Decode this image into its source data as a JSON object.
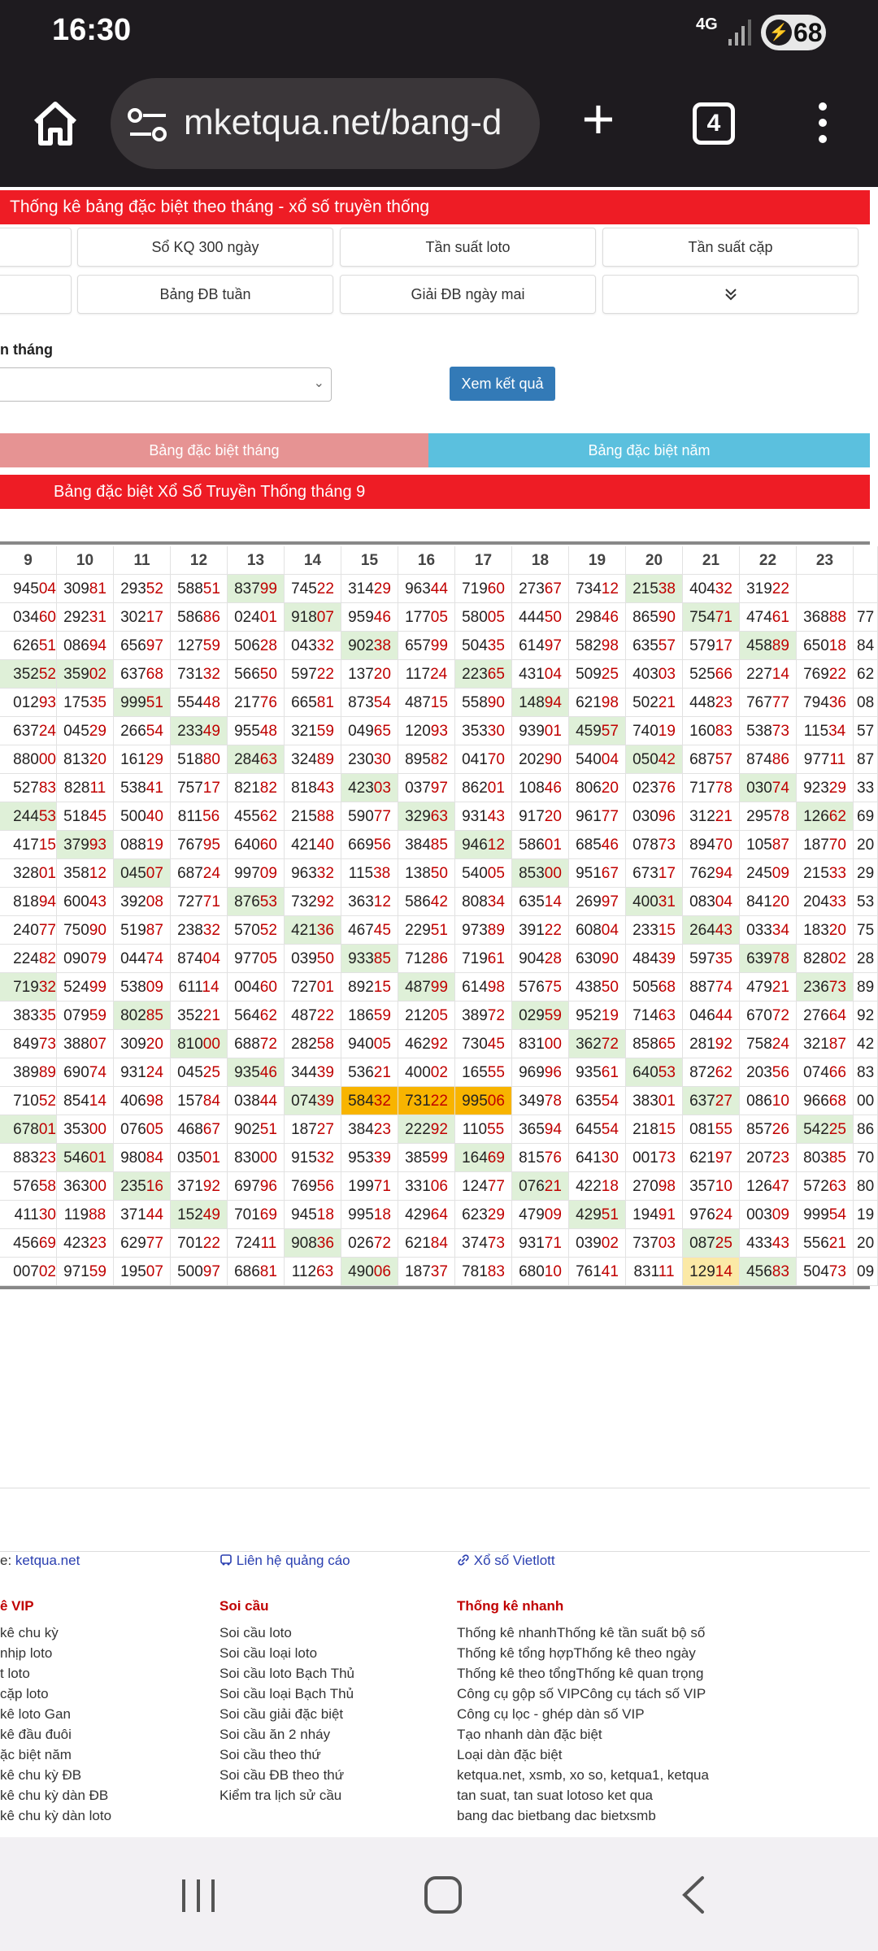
{
  "status": {
    "time": "16:30",
    "network": "4G",
    "battery": "68"
  },
  "browser": {
    "url": "mketqua.net/bang-d",
    "tab_count": "4"
  },
  "page": {
    "header": "Thống kê bảng đặc biệt theo tháng - xổ số truyền thống",
    "nav_row1": [
      "Sổ KQ 300 ngày",
      "Tần suất loto",
      "Tần suất cặp"
    ],
    "nav_row2": [
      "Bảng ĐB tuần",
      "Giải ĐB ngày mai"
    ],
    "month_label": "n tháng",
    "submit_label": "Xem kết quả",
    "tab_month": "Bảng đặc biệt tháng",
    "tab_year": "Bảng đặc biệt năm",
    "table_title": "Bảng đặc biệt Xổ Số Truyền Thống tháng 9"
  },
  "table": {
    "columns": [
      "9",
      "10",
      "11",
      "12",
      "13",
      "14",
      "15",
      "16",
      "17",
      "18",
      "19",
      "20",
      "21",
      "22",
      "23"
    ],
    "rows": [
      [
        "94504",
        "30981",
        "29352",
        "58851",
        "83799",
        "74522",
        "31429",
        "96344",
        "71960",
        "27367",
        "73412",
        "21538",
        "40432",
        "31922",
        "",
        ""
      ],
      [
        "03460",
        "29231",
        "30217",
        "58686",
        "02401",
        "91807",
        "95946",
        "17705",
        "58005",
        "44450",
        "29846",
        "86590",
        "75471",
        "47461",
        "36888",
        "77"
      ],
      [
        "62651",
        "08694",
        "65697",
        "12759",
        "50628",
        "04332",
        "90238",
        "65799",
        "50435",
        "61497",
        "58298",
        "63557",
        "57917",
        "45889",
        "65018",
        "84"
      ],
      [
        "35252",
        "35902",
        "63768",
        "73132",
        "56650",
        "59722",
        "13720",
        "11724",
        "22365",
        "43104",
        "50925",
        "40303",
        "52566",
        "22714",
        "76922",
        "62"
      ],
      [
        "01293",
        "17535",
        "99951",
        "55448",
        "21776",
        "66581",
        "87354",
        "48715",
        "55890",
        "14894",
        "62198",
        "50221",
        "44823",
        "76777",
        "79436",
        "08"
      ],
      [
        "63724",
        "04529",
        "26654",
        "23349",
        "95548",
        "32159",
        "04965",
        "12093",
        "35330",
        "93901",
        "45957",
        "74019",
        "16083",
        "53873",
        "11534",
        "57"
      ],
      [
        "88000",
        "81320",
        "16129",
        "51880",
        "28463",
        "32489",
        "23030",
        "89582",
        "04170",
        "20290",
        "54004",
        "05042",
        "68757",
        "87486",
        "97711",
        "87"
      ],
      [
        "52783",
        "82811",
        "53841",
        "75717",
        "82182",
        "81843",
        "42303",
        "03797",
        "86201",
        "10846",
        "80620",
        "02376",
        "71778",
        "03074",
        "92329",
        "33"
      ],
      [
        "24453",
        "51845",
        "50040",
        "81156",
        "45562",
        "21588",
        "59077",
        "32963",
        "93143",
        "91720",
        "96177",
        "03096",
        "31221",
        "29578",
        "12662",
        "69"
      ],
      [
        "41715",
        "37993",
        "08819",
        "76795",
        "64060",
        "42140",
        "66956",
        "38485",
        "94612",
        "58601",
        "68546",
        "07873",
        "89470",
        "10587",
        "18770",
        "20"
      ],
      [
        "32801",
        "35812",
        "04507",
        "68724",
        "99709",
        "96332",
        "11538",
        "13850",
        "54005",
        "85300",
        "95167",
        "67317",
        "76294",
        "24509",
        "21533",
        "29"
      ],
      [
        "81894",
        "60043",
        "39208",
        "72771",
        "87653",
        "73292",
        "36312",
        "58642",
        "80834",
        "63514",
        "26997",
        "40031",
        "08304",
        "84120",
        "20433",
        "53"
      ],
      [
        "24077",
        "75090",
        "51987",
        "23832",
        "57052",
        "42136",
        "46745",
        "22951",
        "97389",
        "39122",
        "60804",
        "23315",
        "26443",
        "03334",
        "18320",
        "75"
      ],
      [
        "22482",
        "09079",
        "04474",
        "87404",
        "97705",
        "03950",
        "93385",
        "71286",
        "71961",
        "90428",
        "63090",
        "48439",
        "59735",
        "63978",
        "82802",
        "28"
      ],
      [
        "71932",
        "52499",
        "53809",
        "61114",
        "00460",
        "72701",
        "89215",
        "48799",
        "61498",
        "57675",
        "43850",
        "50568",
        "88774",
        "47921",
        "23673",
        "89"
      ],
      [
        "38335",
        "07959",
        "80285",
        "35221",
        "56462",
        "48722",
        "18659",
        "21205",
        "38972",
        "02959",
        "95219",
        "71463",
        "04644",
        "67072",
        "27664",
        "92"
      ],
      [
        "84973",
        "38807",
        "30920",
        "81000",
        "68872",
        "28258",
        "94005",
        "46292",
        "73045",
        "83100",
        "36272",
        "85865",
        "28192",
        "75824",
        "32187",
        "42"
      ],
      [
        "38989",
        "69074",
        "93124",
        "04525",
        "93546",
        "34439",
        "53621",
        "40002",
        "16555",
        "96996",
        "93561",
        "64053",
        "87262",
        "20356",
        "07466",
        "83"
      ],
      [
        "71052",
        "85414",
        "40698",
        "15784",
        "03844",
        "07439",
        "58432",
        "73122",
        "99506",
        "34978",
        "63554",
        "38301",
        "63727",
        "08610",
        "96668",
        "00"
      ],
      [
        "67801",
        "35300",
        "07605",
        "46867",
        "90251",
        "18727",
        "38423",
        "22292",
        "11055",
        "36594",
        "64554",
        "21815",
        "08155",
        "85726",
        "54225",
        "86"
      ],
      [
        "88323",
        "54601",
        "98084",
        "03501",
        "83000",
        "91532",
        "95339",
        "38599",
        "16469",
        "81576",
        "64130",
        "00173",
        "62197",
        "20723",
        "80385",
        "70"
      ],
      [
        "57658",
        "36300",
        "23516",
        "37192",
        "69796",
        "76956",
        "19971",
        "33106",
        "12477",
        "07621",
        "42218",
        "27098",
        "35710",
        "12647",
        "57263",
        "80"
      ],
      [
        "41130",
        "11988",
        "37144",
        "15249",
        "70169",
        "94518",
        "99518",
        "42964",
        "62329",
        "47909",
        "42951",
        "19491",
        "97624",
        "00309",
        "99954",
        "19"
      ],
      [
        "45669",
        "42323",
        "62977",
        "70122",
        "72411",
        "90836",
        "02672",
        "62184",
        "37473",
        "93171",
        "03902",
        "73703",
        "08725",
        "43343",
        "55621",
        "20"
      ],
      [
        "00702",
        "97159",
        "19507",
        "50097",
        "68681",
        "11263",
        "49006",
        "18737",
        "78183",
        "68010",
        "76141",
        "83111",
        "12914",
        "45683",
        "50473",
        "09"
      ]
    ],
    "hl_green": [
      [
        0,
        4
      ],
      [
        0,
        11
      ],
      [
        1,
        5
      ],
      [
        1,
        12
      ],
      [
        2,
        6
      ],
      [
        2,
        13
      ],
      [
        3,
        0
      ],
      [
        3,
        1
      ],
      [
        3,
        8
      ],
      [
        4,
        2
      ],
      [
        4,
        9
      ],
      [
        5,
        3
      ],
      [
        5,
        10
      ],
      [
        6,
        4
      ],
      [
        6,
        11
      ],
      [
        7,
        6
      ],
      [
        7,
        13
      ],
      [
        8,
        0
      ],
      [
        8,
        7
      ],
      [
        8,
        14
      ],
      [
        9,
        1
      ],
      [
        9,
        8
      ],
      [
        10,
        2
      ],
      [
        10,
        9
      ],
      [
        11,
        4
      ],
      [
        11,
        11
      ],
      [
        12,
        5
      ],
      [
        12,
        12
      ],
      [
        13,
        6
      ],
      [
        13,
        13
      ],
      [
        14,
        0
      ],
      [
        14,
        7
      ],
      [
        14,
        14
      ],
      [
        15,
        2
      ],
      [
        15,
        9
      ],
      [
        16,
        3
      ],
      [
        16,
        10
      ],
      [
        17,
        4
      ],
      [
        17,
        11
      ],
      [
        18,
        5
      ],
      [
        18,
        12
      ],
      [
        19,
        0
      ],
      [
        19,
        7
      ],
      [
        19,
        14
      ],
      [
        20,
        1
      ],
      [
        20,
        8
      ],
      [
        21,
        2
      ],
      [
        21,
        9
      ],
      [
        22,
        3
      ],
      [
        22,
        10
      ],
      [
        23,
        5
      ],
      [
        23,
        12
      ],
      [
        24,
        6
      ],
      [
        24,
        13
      ]
    ],
    "hl_orange": [
      [
        18,
        6
      ],
      [
        18,
        7
      ],
      [
        18,
        8
      ]
    ],
    "hl_yellow": [
      [
        24,
        12
      ]
    ]
  },
  "footer": {
    "links": [
      "ketqua.net",
      "Liên hệ quảng cáo",
      "Xổ số Vietlott"
    ],
    "link_prefix": "e:",
    "col1": {
      "title": "ê VIP",
      "items": [
        "kê chu kỳ",
        "nhịp loto",
        "t loto",
        "cặp loto",
        "kê loto Gan",
        "kê đầu đuôi",
        "ặc biệt năm",
        "kê chu kỳ ĐB",
        "kê chu kỳ dàn ĐB",
        "kê chu kỳ dàn loto"
      ]
    },
    "col2": {
      "title": "Soi cầu",
      "items": [
        "Soi cầu loto",
        "Soi cầu loại loto",
        "Soi cầu loto Bạch Thủ",
        "Soi cầu loại Bạch Thủ",
        "Soi cầu giải đặc biệt",
        "Soi cầu ăn 2 nháy",
        "Soi cầu theo thứ",
        "Soi cầu ĐB theo thứ",
        "Kiểm tra lịch sử cầu"
      ]
    },
    "col3": {
      "title": "Thống kê nhanh",
      "items": [
        "Thống kê nhanhThống kê tần suất bộ số",
        "Thống kê tổng hợpThống kê theo ngày",
        "Thống kê theo tổngThống kê quan trọng",
        "Công cụ gộp số VIPCông cụ tách số VIP",
        "Công cụ lọc - ghép dàn số VIP",
        "Tạo nhanh dàn đặc biệt",
        "Loại dàn đặc biệt",
        "ketqua.net, xsmb, xo so, ketqua1, ketqua",
        "tan suat, tan suat lotoso ket qua",
        "bang dac bietbang dac bietxsmb"
      ]
    }
  }
}
